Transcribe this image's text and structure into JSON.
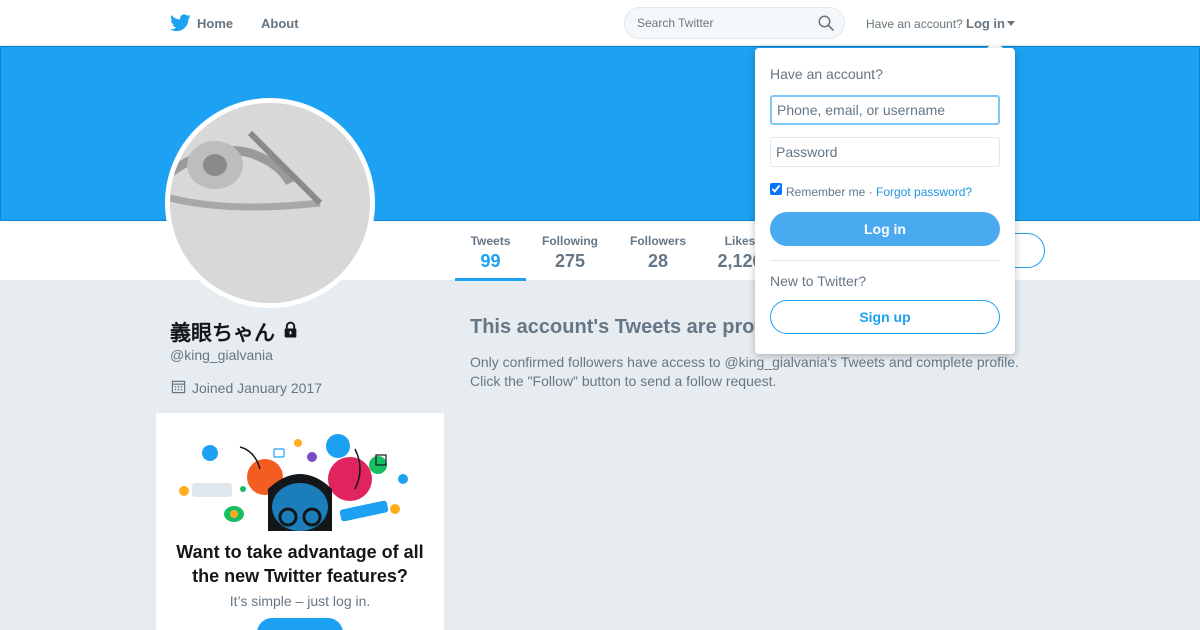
{
  "nav": {
    "home_label": "Home",
    "about_label": "About",
    "search_placeholder": "Search Twitter",
    "have_account": "Have an account?",
    "login_label": "Log in",
    "icons": {
      "logo": "twitter-bird-icon",
      "search": "search-icon",
      "caret": "caret-down-icon"
    }
  },
  "profile": {
    "display_name": "義眼ちゃん",
    "screen_name": "@king_gialvania",
    "joined": "Joined January 2017",
    "protected": true
  },
  "stats": [
    {
      "label": "Tweets",
      "value": "99",
      "active": true
    },
    {
      "label": "Following",
      "value": "275",
      "active": false
    },
    {
      "label": "Followers",
      "value": "28",
      "active": false
    },
    {
      "label": "Likes",
      "value": "2,126",
      "active": false
    }
  ],
  "promo": {
    "title": "Want to take advantage of all the new Twitter features?",
    "subtitle": "It’s simple – just log in."
  },
  "protected_message": {
    "title": "This account's Tweets are protected.",
    "body": "Only confirmed followers have access to @king_gialvania's Tweets and complete profile. Click the \"Follow\" button to send a follow request."
  },
  "login_dropdown": {
    "heading": "Have an account?",
    "username_placeholder": "Phone, email, or username",
    "password_placeholder": "Password",
    "remember_label": "Remember me ·",
    "remember_checked": true,
    "forgot_label": "Forgot password?",
    "login_button": "Log in",
    "new_label": "New to Twitter?",
    "signup_button": "Sign up"
  },
  "colors": {
    "brand": "#1da1f2",
    "background": "#e6ecf0",
    "muted_text": "#657786"
  }
}
